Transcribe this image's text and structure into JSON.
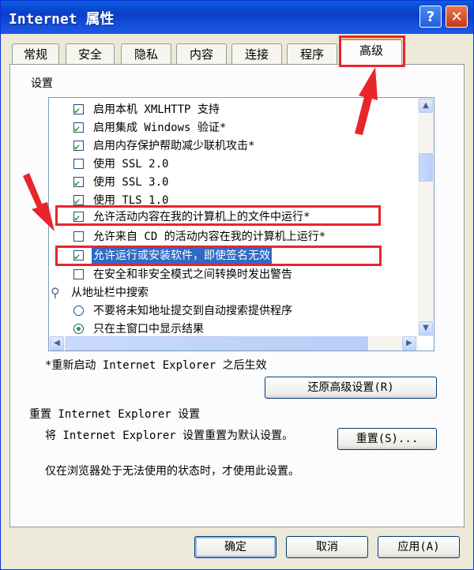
{
  "window": {
    "title": "Internet 属性",
    "help_glyph": "?",
    "close_glyph": "✕"
  },
  "tabs": [
    {
      "label": "常规"
    },
    {
      "label": "安全"
    },
    {
      "label": "隐私"
    },
    {
      "label": "内容"
    },
    {
      "label": "连接"
    },
    {
      "label": "程序"
    },
    {
      "label": "高级",
      "active": true
    }
  ],
  "settings": {
    "group_label": "设置",
    "items": [
      {
        "type": "checkbox",
        "checked": true,
        "text": "启用本机 XMLHTTP 支持"
      },
      {
        "type": "checkbox",
        "checked": true,
        "text": "启用集成 Windows 验证*"
      },
      {
        "type": "checkbox",
        "checked": true,
        "text": "启用内存保护帮助减少联机攻击*"
      },
      {
        "type": "checkbox",
        "checked": false,
        "text": "使用 SSL 2.0"
      },
      {
        "type": "checkbox",
        "checked": true,
        "text": "使用 SSL 3.0"
      },
      {
        "type": "checkbox",
        "checked": true,
        "text": "使用 TLS 1.0"
      },
      {
        "type": "checkbox",
        "checked": true,
        "text": "允许活动内容在我的计算机上的文件中运行*"
      },
      {
        "type": "checkbox",
        "checked": false,
        "text": "允许来自 CD 的活动内容在我的计算机上运行*"
      },
      {
        "type": "checkbox",
        "checked": true,
        "text": "允许运行或安装软件，即使签名无效",
        "selected": true
      },
      {
        "type": "checkbox",
        "checked": false,
        "text": "在安全和非安全模式之间转换时发出警告"
      },
      {
        "type": "group",
        "text": "从地址栏中搜索"
      },
      {
        "type": "radio",
        "checked": false,
        "text": "不要将未知地址提交到自动搜索提供程序"
      },
      {
        "type": "radio",
        "checked": true,
        "text": "只在主窗口中显示结果"
      }
    ],
    "restart_note": "*重新启动 Internet Explorer 之后生效",
    "restore_button": "还原高级设置(R)"
  },
  "reset": {
    "title": "重置 Internet Explorer 设置",
    "description": "将 Internet Explorer 设置重置为默认设置。",
    "button": "重置(S)...",
    "note": "仅在浏览器处于无法使用的状态时，才使用此设置。"
  },
  "footer": {
    "ok": "确定",
    "cancel": "取消",
    "apply": "应用(A)"
  },
  "colors": {
    "annotation": "#e8252a",
    "selection": "#316ac5",
    "title_bar": "#0a3ec9"
  }
}
